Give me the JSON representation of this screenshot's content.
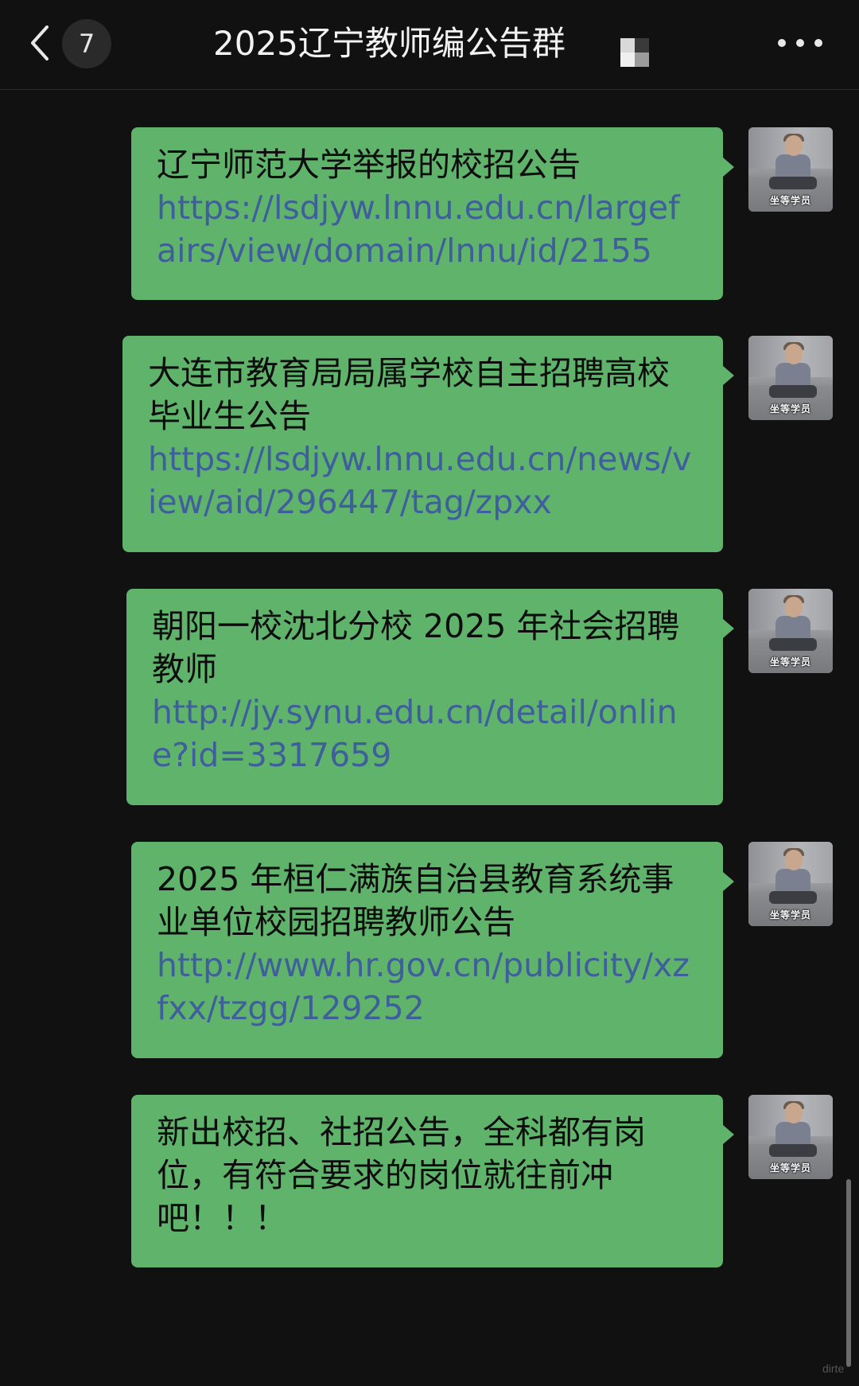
{
  "header": {
    "unread_count": "7",
    "title": "2025辽宁教师编公告群",
    "back_icon": "chevron-left-icon",
    "more_icon": "more-dots-icon"
  },
  "messages": [
    {
      "text": "辽宁师范大学举报的校招公告",
      "link": "https://lsdjyw.lnnu.edu.cn/largefairs/view/domain/lnnu/id/2155"
    },
    {
      "text": "大连市教育局局属学校自主招聘高校毕业生公告",
      "link": "https://lsdjyw.lnnu.edu.cn/news/view/aid/296447/tag/zpxx"
    },
    {
      "text": "朝阳一校沈北分校 2025 年社会招聘教师",
      "link": "http://jy.synu.edu.cn/detail/online?id=3317659"
    },
    {
      "text": "2025 年桓仁满族自治县教育系统事业单位校园招聘教师公告",
      "link": "http://www.hr.gov.cn/publicity/xzfxx/tzgg/129252"
    },
    {
      "text": "新出校招、社招公告，全科都有岗位，有符合要求的岗位就往前冲吧！！！",
      "link": ""
    }
  ],
  "avatar": {
    "caption": "坐等学员"
  },
  "colors": {
    "background": "#111111",
    "bubble": "#5fb36b",
    "link": "#3f5f9c"
  },
  "watermark": "dirte"
}
